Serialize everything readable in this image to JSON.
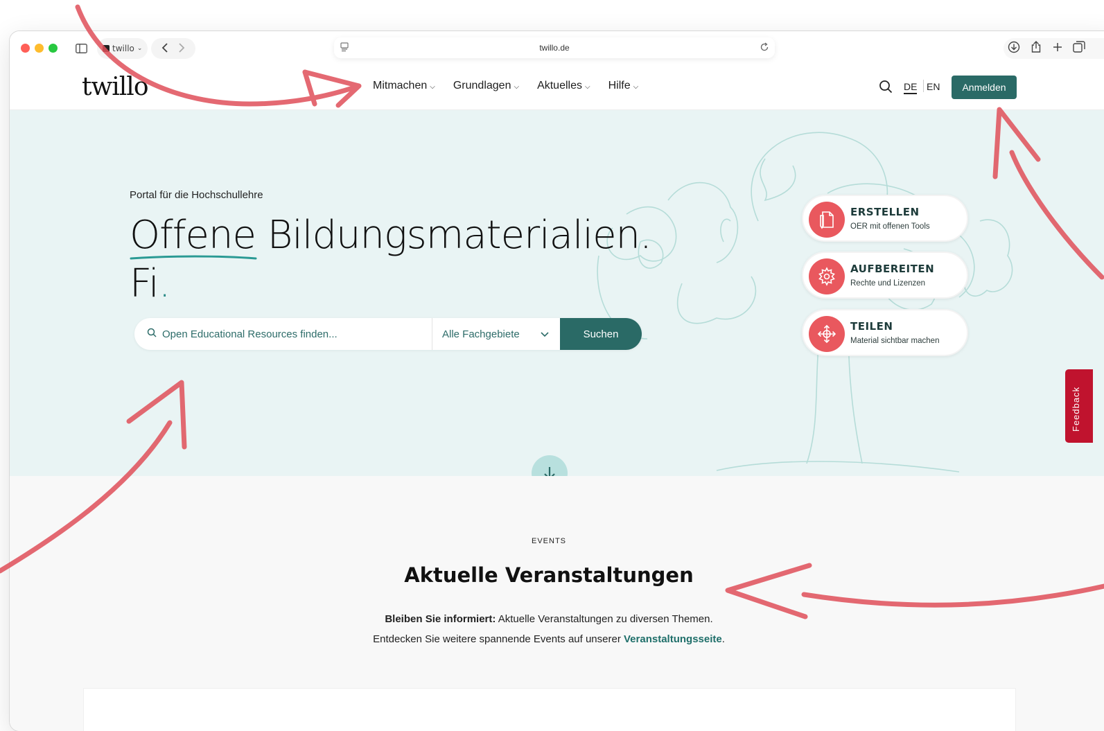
{
  "browser": {
    "tab_title": "twillo",
    "url": "twillo.de"
  },
  "header": {
    "logo": "twillo",
    "nav": [
      {
        "label": "Mitmachen"
      },
      {
        "label": "Grundlagen"
      },
      {
        "label": "Aktuelles"
      },
      {
        "label": "Hilfe"
      }
    ],
    "lang_de": "DE",
    "lang_en": "EN",
    "login": "Anmelden"
  },
  "hero": {
    "kicker": "Portal für die Hochschullehre",
    "headline_line1": "Offene Bildungsmaterialien.",
    "headline_line2": "Fi",
    "headline_dot": ".",
    "search_placeholder": "Open Educational Resources finden...",
    "subject_select": "Alle Fachgebiete",
    "search_button": "Suchen",
    "cards": [
      {
        "title": "ERSTELLEN",
        "subtitle": "OER mit offenen Tools",
        "icon": "document-icon"
      },
      {
        "title": "AUFBEREITEN",
        "subtitle": "Rechte und Lizenzen",
        "icon": "gear-icon"
      },
      {
        "title": "TEILEN",
        "subtitle": "Material sichtbar machen",
        "icon": "move-arrows-icon"
      }
    ],
    "feedback": "Feedback"
  },
  "events": {
    "kicker": "EVENTS",
    "title": "Aktuelle Veranstaltungen",
    "intro_bold": "Bleiben Sie informiert:",
    "intro_rest": " Aktuelle Veranstaltungen zu diversen Themen.",
    "line2_prefix": "Entdecken Sie weitere spannende Events auf unserer ",
    "line2_link": "Veranstaltungsseite",
    "line2_suffix": "."
  },
  "colors": {
    "accent": "#2a6a66",
    "hero_bg": "#e9f4f4",
    "card_icon": "#e9585e",
    "feedback": "#c0132e",
    "annotation": "#e0505a"
  }
}
